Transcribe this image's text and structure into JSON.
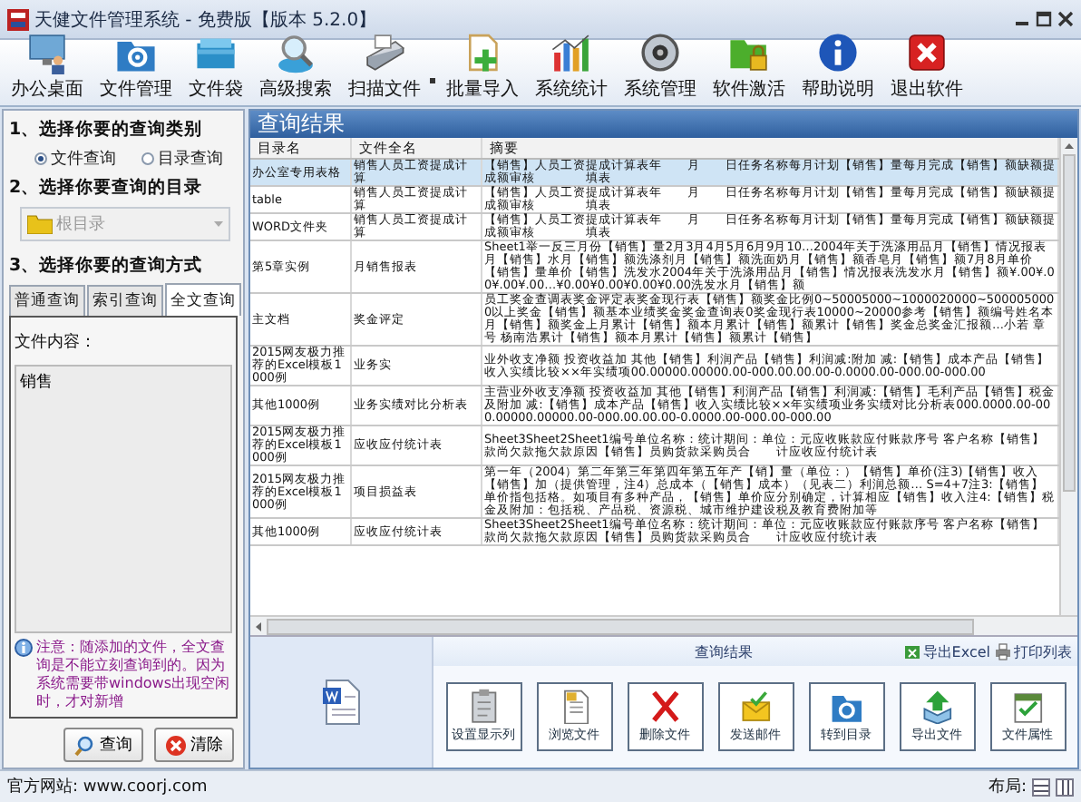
{
  "window": {
    "title": "天健文件管理系统 - 免费版【版本 5.2.0】"
  },
  "toolbar": [
    {
      "label": "办公桌面",
      "dropdown": false
    },
    {
      "label": "文件管理",
      "dropdown": false
    },
    {
      "label": "文件袋",
      "dropdown": false
    },
    {
      "label": "高级搜索",
      "dropdown": false
    },
    {
      "label": "扫描文件",
      "dropdown": true
    },
    {
      "label": "批量导入",
      "dropdown": false
    },
    {
      "label": "系统统计",
      "dropdown": false
    },
    {
      "label": "系统管理",
      "dropdown": false
    },
    {
      "label": "软件激活",
      "dropdown": false
    },
    {
      "label": "帮助说明",
      "dropdown": false
    },
    {
      "label": "退出软件",
      "dropdown": false
    }
  ],
  "query_panel": {
    "step1_title": "1、选择你要的查询类别",
    "types": [
      {
        "label": "文件查询",
        "selected": true
      },
      {
        "label": "目录查询",
        "selected": false
      }
    ],
    "step2_title": "2、选择你要查询的目录",
    "directory": {
      "value": "根目录",
      "disabled": true
    },
    "step3_title": "3、选择你要的查询方式",
    "tabs": [
      {
        "label": "普通查询",
        "selected": false
      },
      {
        "label": "索引查询",
        "selected": false
      },
      {
        "label": "全文查询",
        "selected": true
      }
    ],
    "content_label": "文件内容：",
    "content_value": "销售",
    "note": "注意：随添加的文件，全文查询是不能立刻查询到的。因为系统需要带windows出现空闲时，才对新增",
    "buttons": [
      {
        "label": "查询"
      },
      {
        "label": "清除"
      }
    ]
  },
  "results": {
    "title": "查询结果",
    "columns": [
      "目录名",
      "文件全名",
      "摘要"
    ],
    "rows": [
      {
        "directory": "办公室专用表格",
        "file": "销售人员工资提成计算",
        "summary": "【销售】人员工资提成计算表年　　月　　日任务名称每月计划【销售】量每月完成【销售】额缺额提成额审核　　　　填表",
        "selected": true
      },
      {
        "directory": "table",
        "file": "销售人员工资提成计算",
        "summary": "【销售】人员工资提成计算表年　　月　　日任务名称每月计划【销售】量每月完成【销售】额缺额提成额审核　　　　填表",
        "selected": false
      },
      {
        "directory": "WORD文件夹",
        "file": "销售人员工资提成计算",
        "summary": "【销售】人员工资提成计算表年　　月　　日任务名称每月计划【销售】量每月完成【销售】额缺额提成额审核　　　　填表",
        "selected": false
      },
      {
        "directory": "第5章实例",
        "file": "月销售报表",
        "summary": "Sheet1举一反三月份【销售】量2月3月4月5月6月9月10…2004年关于洗涤用品月【销售】情况报表月【销售】水月【销售】额洗涤剂月【销售】额洗面奶月【销售】额香皂月【销售】额7月8月单价【销售】量单价【销售】洗发水2004年关于洗涤用品月【销售】情况报表洗发水月【销售】额¥.00¥.00¥.00¥.00…¥0.00¥0.00¥0.00¥0.00洗发水月【销售】额",
        "selected": false
      },
      {
        "directory": "主文档",
        "file": "奖金评定",
        "summary": "员工奖金查调表奖金评定表奖金现行表【销售】额奖金比例0~50005000~1000020000~5000050000以上奖金【销售】额基本业绩奖金奖金查询表0奖金现行表10000~20000参考【销售】额编号姓名本月【销售】额奖金上月累计【销售】额本月累计【销售】额累计【销售】奖金总奖金汇报额…小若 章号 杨南浩累计【销售】额本月累计【销售】额累计【销售】",
        "selected": false
      },
      {
        "directory": "2015网友极力推荐的Excel模板1000例",
        "file": "业务实",
        "summary": "业外收支净额 投资收益加 其他【销售】利润产品【销售】利润减:附加 减:【销售】成本产品【销售】收入实绩比较××年实绩项00.00000.00000.00-000.00.00.00-0.0000.00-000.00-000.00",
        "selected": false
      },
      {
        "directory": "其他1000例",
        "file": "业务实绩对比分析表",
        "summary": "主营业外收支净额 投资收益加 其他【销售】利润产品【销售】利润减:【销售】毛利产品【销售】税金及附加 减:【销售】成本产品【销售】收入实绩比较××年实绩项业务实绩对比分析表000.0000.00-000.00000.00000.00-000.00.00.00-0.0000.00-000.00-000.00",
        "selected": false
      },
      {
        "directory": "2015网友极力推荐的Excel模板1000例",
        "file": "应收应付统计表",
        "summary": "Sheet3Sheet2Sheet1编号单位名称：统计期间：单位：元应收账款应付账款序号 客户名称【销售】款尚欠款拖欠款原因【销售】员购货款采购员合　　计应收应付统计表",
        "selected": false
      },
      {
        "directory": "2015网友极力推荐的Excel模板1000例",
        "file": "项目损益表",
        "summary": "第一年（2004）第二年第三年第四年第五年产【销】量（单位：）【销售】单价(注3)【销售】收入【销售】加（提供管理，注4）总成本（【销售】成本）（见表二）利润总额… S=4+7注3:【销售】单价指包括格。如项目有多种产品，【销售】单价应分别确定，计算相应【销售】收入注4:【销售】税金及附加：包括税、产品税、资源税、城市维护建设税及教育费附加等",
        "selected": false
      },
      {
        "directory": "其他1000例",
        "file": "应收应付统计表",
        "summary": "Sheet3Sheet2Sheet1编号单位名称：统计期间：单位：元应收账款应付账款序号 客户名称【销售】款尚欠款拖欠款原因【销售】员购货款采购员合　　计应收应付统计表",
        "selected": false
      }
    ],
    "action_panel": {
      "title": "查询结果",
      "links": [
        "导出Excel",
        "打印列表"
      ],
      "buttons": [
        {
          "label": "设置显示列"
        },
        {
          "label": "浏览文件"
        },
        {
          "label": "删除文件"
        },
        {
          "label": "发送邮件"
        },
        {
          "label": "转到目录"
        },
        {
          "label": "导出文件"
        },
        {
          "label": "文件属性"
        }
      ]
    }
  },
  "status_bar": {
    "website": "官方网站: www.coorj.com",
    "layout_label": "布局:"
  }
}
